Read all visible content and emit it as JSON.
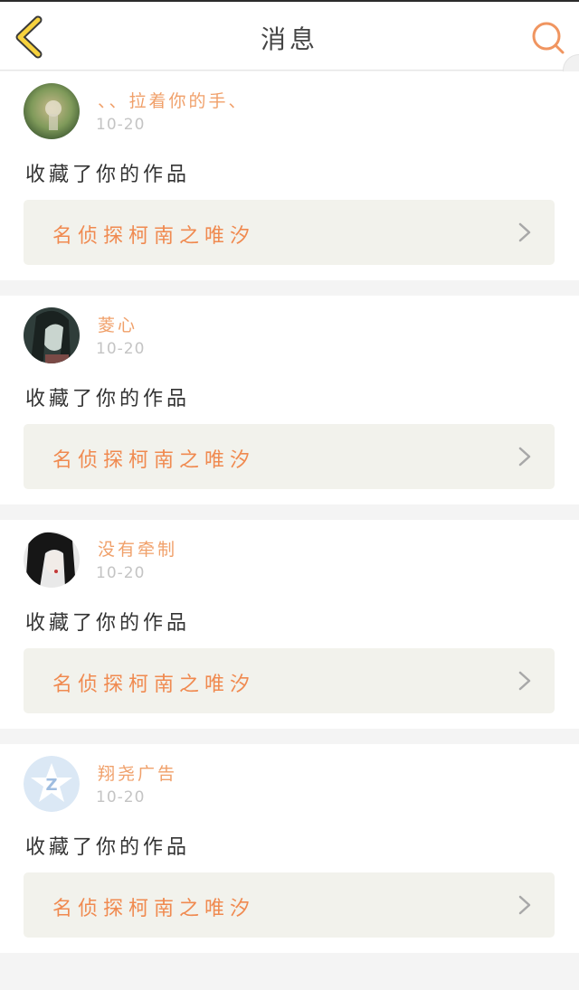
{
  "header": {
    "title": "消息"
  },
  "messages": [
    {
      "username": "、、拉着你的手、",
      "date": "10-20",
      "action": "收藏了你的作品",
      "work_title": "名侦探柯南之唯汐",
      "avatar_colors": [
        "#6b8a4e",
        "#c7b38a"
      ]
    },
    {
      "username": "菱心",
      "date": "10-20",
      "action": "收藏了你的作品",
      "work_title": "名侦探柯南之唯汐",
      "avatar_colors": [
        "#3b4a45",
        "#9fb1a8"
      ]
    },
    {
      "username": "没有牵制",
      "date": "10-20",
      "action": "收藏了你的作品",
      "work_title": "名侦探柯南之唯汐",
      "avatar_colors": [
        "#1f1f1f",
        "#d9d9d9"
      ]
    },
    {
      "username": "翔尧广告",
      "date": "10-20",
      "action": "收藏了你的作品",
      "work_title": "名侦探柯南之唯汐",
      "avatar_colors": [
        "#dbe9f6",
        "#a9c5e6"
      ]
    }
  ]
}
